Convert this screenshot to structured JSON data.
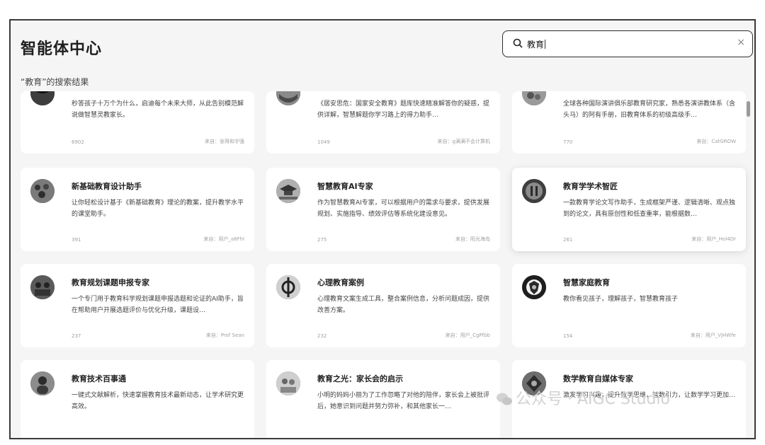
{
  "header": {
    "title": "智能体中心"
  },
  "search": {
    "value": "教育",
    "clear_icon": "×"
  },
  "results_label": "“教育”的搜索结果",
  "cards": [
    {
      "name": "",
      "desc": "秒答孩子十万个为什么，启迪每个未来大师，从此告别模范解说做智慧灵教家长。",
      "likes": "6902",
      "source": "来自：张哥和宇强",
      "icon": "owl-avatar-icon"
    },
    {
      "name": "",
      "desc": "《居安思危：国家安全教育》题库快速精准解答你的疑惑，提供详解，智慧解题你学习路上的得力助手…",
      "likes": "1049",
      "source": "来自：g满满不会计算机",
      "icon": "emblem-avatar-icon"
    },
    {
      "name": "",
      "desc": "全球各种国际演讲俱乐部教育研究家，熟悉各演讲教体系（含头马）的阿有手册，旧教育体系的初级高级手…",
      "likes": "770",
      "source": "来自：CatGROW",
      "icon": "globe-avatar-icon"
    },
    {
      "name": "新基础教育设计助手",
      "desc": "让你轻松设计基于《新基础教育》理论的教案，提升教学水平的课堂助手。",
      "likes": "391",
      "source": "来自：用户_a8Fhl",
      "icon": "crowd-avatar-icon"
    },
    {
      "name": "智慧教育AI专家",
      "desc": "作为智慧教育AI专家，可以根据用户的需求与要求，提供发展规划、实施指导、绩效评估等系统化建设意见。",
      "likes": "275",
      "source": "来自：阳光海岛",
      "icon": "graduation-cap-icon"
    },
    {
      "name": "教育学学术智匠",
      "desc": "一款教育学论文写作助手，生成框架严谨、逻辑清晰、观点独到的论文，具有原创性和低查重率，能根据数…",
      "likes": "261",
      "source": "来自：用户_Hol4Dr",
      "icon": "pillars-avatar-icon"
    },
    {
      "name": "教育规划课题申报专家",
      "desc": "一个专门用于教育科学规划课题申报选题和论证的AI助手，旨在帮助用户开展选题评价与优化升级，课题设…",
      "likes": "237",
      "source": "来自：Prof Sean",
      "icon": "team-avatar-icon"
    },
    {
      "name": "心理教育案例",
      "desc": "心理教育文案生成工具，整合案例信息，分析问题成因，提供改善方案。",
      "likes": "232",
      "source": "来自：用户_CgPfbb",
      "icon": "sword-emblem-icon"
    },
    {
      "name": "智慧家庭教育",
      "desc": "教你看见孩子，理解孩子，智慧教育孩子",
      "likes": "154",
      "source": "来自：用户_VjHWfe",
      "icon": "shield-avatar-icon"
    },
    {
      "name": "教育技术百事通",
      "desc": "一键式文献解析，快速掌握教育技术最新动态，让学术研究更高效。",
      "likes": "",
      "source": "",
      "icon": "person-avatar-icon"
    },
    {
      "name": "教育之光：家长会的启示",
      "desc": "小明的妈妈小丽为了工作忽略了对他的陪伴，家长会上被批评后，她意识到问题并努力弥补，和其他家长一…",
      "likes": "",
      "source": "",
      "icon": "meeting-avatar-icon"
    },
    {
      "name": "数学教育自媒体专家",
      "desc": "激发学习兴趣，提升数学思维，智数引力，让数学学习更加…",
      "likes": "",
      "source": "",
      "icon": "ornament-avatar-icon"
    }
  ],
  "watermark": "公众号 · AIGC Studio"
}
